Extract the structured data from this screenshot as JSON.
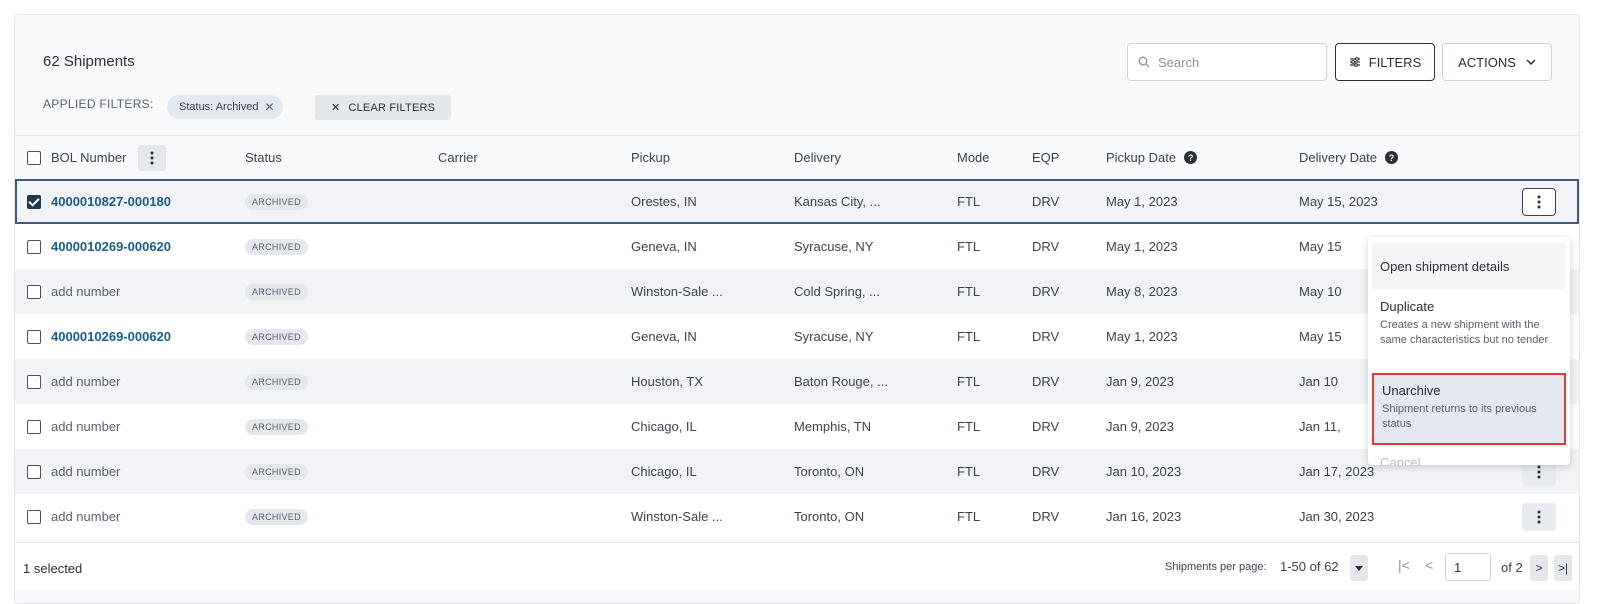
{
  "header": {
    "title": "62 Shipments",
    "applied_filters_label": "APPLIED FILTERS:",
    "filter_chip": "Status: Archived",
    "clear_filters": "CLEAR FILTERS",
    "search_placeholder": "Search",
    "filters_button": "FILTERS",
    "actions_button": "ACTIONS"
  },
  "columns": {
    "bol": "BOL Number",
    "status": "Status",
    "carrier": "Carrier",
    "pickup": "Pickup",
    "delivery": "Delivery",
    "mode": "Mode",
    "eqp": "EQP",
    "pickup_date": "Pickup Date",
    "delivery_date": "Delivery Date"
  },
  "rows": [
    {
      "bol": "4000010827-000180",
      "bol_link": true,
      "status": "ARCHIVED",
      "carrier": "",
      "pickup": "Orestes, IN",
      "delivery": "Kansas City, ...",
      "mode": "FTL",
      "eqp": "DRV",
      "pickup_date": "May 1, 2023",
      "delivery_date": "May 15, 2023",
      "checked": true
    },
    {
      "bol": "4000010269-000620",
      "bol_link": true,
      "status": "ARCHIVED",
      "carrier": "",
      "pickup": "Geneva, IN",
      "delivery": "Syracuse, NY",
      "mode": "FTL",
      "eqp": "DRV",
      "pickup_date": "May 1, 2023",
      "delivery_date": "May 15",
      "checked": false
    },
    {
      "bol": "add number",
      "bol_link": false,
      "status": "ARCHIVED",
      "carrier": "",
      "pickup": "Winston-Sale ...",
      "delivery": "Cold Spring, ...",
      "mode": "FTL",
      "eqp": "DRV",
      "pickup_date": "May 8, 2023",
      "delivery_date": "May 10",
      "checked": false
    },
    {
      "bol": "4000010269-000620",
      "bol_link": true,
      "status": "ARCHIVED",
      "carrier": "",
      "pickup": "Geneva, IN",
      "delivery": "Syracuse, NY",
      "mode": "FTL",
      "eqp": "DRV",
      "pickup_date": "May 1, 2023",
      "delivery_date": "May 15",
      "checked": false
    },
    {
      "bol": "add number",
      "bol_link": false,
      "status": "ARCHIVED",
      "carrier": "",
      "pickup": "Houston, TX",
      "delivery": "Baton Rouge, ...",
      "mode": "FTL",
      "eqp": "DRV",
      "pickup_date": "Jan 9, 2023",
      "delivery_date": "Jan 10",
      "checked": false
    },
    {
      "bol": "add number",
      "bol_link": false,
      "status": "ARCHIVED",
      "carrier": "",
      "pickup": "Chicago, IL",
      "delivery": "Memphis, TN",
      "mode": "FTL",
      "eqp": "DRV",
      "pickup_date": "Jan 9, 2023",
      "delivery_date": "Jan 11,",
      "checked": false
    },
    {
      "bol": "add number",
      "bol_link": false,
      "status": "ARCHIVED",
      "carrier": "",
      "pickup": "Chicago, IL",
      "delivery": "Toronto, ON",
      "mode": "FTL",
      "eqp": "DRV",
      "pickup_date": "Jan 10, 2023",
      "delivery_date": "Jan 17, 2023",
      "checked": false
    },
    {
      "bol": "add number",
      "bol_link": false,
      "status": "ARCHIVED",
      "carrier": "",
      "pickup": "Winston-Sale ...",
      "delivery": "Toronto, ON",
      "mode": "FTL",
      "eqp": "DRV",
      "pickup_date": "Jan 16, 2023",
      "delivery_date": "Jan 30, 2023",
      "checked": false
    }
  ],
  "menu": {
    "open": "Open shipment details",
    "duplicate_title": "Duplicate",
    "duplicate_desc": "Creates a new shipment with the same characteristics but no tender",
    "unarchive_title": "Unarchive",
    "unarchive_desc": "Shipment returns to its previous status",
    "cancel": "Cancel"
  },
  "footer": {
    "selected": "1 selected",
    "per_page_label": "Shipments per page:",
    "range": "1-50 of 62",
    "page": "1",
    "of_pages": "of 2"
  },
  "colors": {
    "link": "#1a5d8a",
    "selected_outline": "#3d5a80",
    "highlight_border": "#e53935"
  }
}
